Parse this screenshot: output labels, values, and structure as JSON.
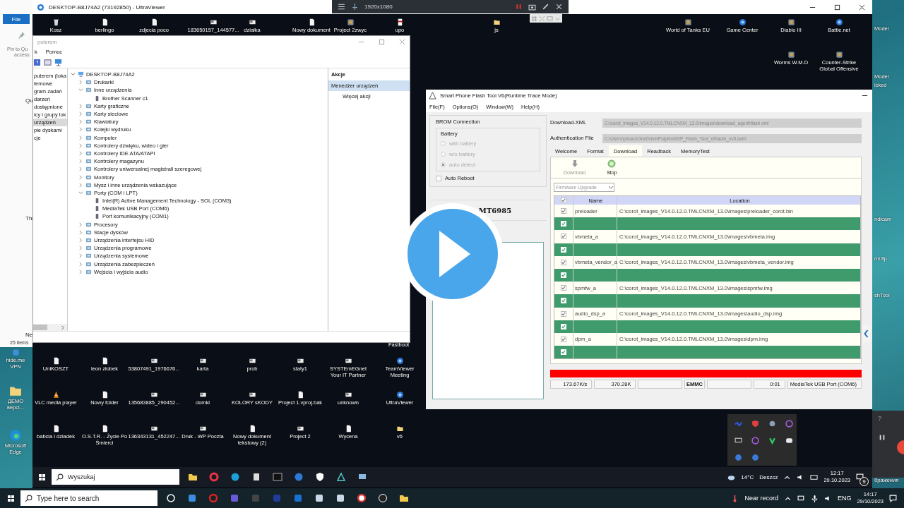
{
  "local_explorer": {
    "tab": "File",
    "pin_label": "Pin to Qu",
    "pin_label_2": "access",
    "nav_items": [
      "Qu",
      "Thi",
      "Ne"
    ],
    "status": "25 items"
  },
  "local_desktop_left": [
    {
      "label": "hide.me VPN",
      "kind": "app"
    },
    {
      "label": "ДЕМО версi...",
      "kind": "folder"
    },
    {
      "label": "Microsoft Edge",
      "kind": "web"
    }
  ],
  "local_desktop_right": [
    "Model",
    "Model",
    "icked",
    "ndicam",
    "mi.flp",
    "shTool",
    "бражения"
  ],
  "recorder_bar": {
    "resolution": "1920x1080"
  },
  "remote_window": {
    "title": "DESKTOP-B8J74A2 (73192850) - UltraViewer"
  },
  "remote_desktop_top": [
    {
      "label": "Kosz",
      "kind": "recycle"
    },
    {
      "label": "berlingo",
      "kind": "file"
    },
    {
      "label": "zdjecia poco",
      "kind": "file"
    },
    {
      "label": "183650157_144577...",
      "kind": "image"
    },
    {
      "label": "działka",
      "kind": "image"
    },
    {
      "label": "Nowy dokument",
      "kind": "file"
    },
    {
      "label": "Project 2zwyc",
      "kind": "app"
    },
    {
      "label": "upo",
      "kind": "pdf"
    },
    {
      "label": "js",
      "kind": "folder"
    },
    {
      "label": "World of Tanks EU",
      "kind": "app"
    },
    {
      "label": "Game Center",
      "kind": "web"
    },
    {
      "label": "Diablo III",
      "kind": "app"
    },
    {
      "label": "Battle.net",
      "kind": "web"
    },
    {
      "label": "Worms W.M.D",
      "kind": "app"
    },
    {
      "label": "Counter-Strike Global Offensive",
      "kind": "app"
    }
  ],
  "remote_desktop_bottom": [
    {
      "label": "UniKOSZT",
      "kind": "file"
    },
    {
      "label": "leon złobek",
      "kind": "file"
    },
    {
      "label": "53807491_1976676...",
      "kind": "image"
    },
    {
      "label": "karta",
      "kind": "image"
    },
    {
      "label": "prob",
      "kind": "image"
    },
    {
      "label": "staty1",
      "kind": "image"
    },
    {
      "label": "SYSTEmEGnet Your IT Partner",
      "kind": "image"
    },
    {
      "label": "TeamViewer Meeting",
      "kind": "web"
    },
    {
      "label": "VLC media player",
      "kind": "cone"
    },
    {
      "label": "Nowy folder",
      "kind": "file"
    },
    {
      "label": "135683885_290452...",
      "kind": "image"
    },
    {
      "label": "domki",
      "kind": "image"
    },
    {
      "label": "KOLORY sKODY",
      "kind": "image"
    },
    {
      "label": "Project 1.vproj.bak",
      "kind": "file"
    },
    {
      "label": "unknown",
      "kind": "image"
    },
    {
      "label": "UltraViewer",
      "kind": "web"
    },
    {
      "label": "babcia i dziadek",
      "kind": "file"
    },
    {
      "label": "O.S.T.R. - Życie Po Śmierci",
      "kind": "file"
    },
    {
      "label": "136343131_452247...",
      "kind": "image"
    },
    {
      "label": "Druk - WP Poczta",
      "kind": "image"
    },
    {
      "label": "Nowy dokument tekstowy (2)",
      "kind": "file"
    },
    {
      "label": "Project 2",
      "kind": "image"
    },
    {
      "label": "Wycena",
      "kind": "file"
    },
    {
      "label": "v6",
      "kind": "folder"
    }
  ],
  "remote_desktop_hidden_label": "Fastboot",
  "device_manager": {
    "title": "puterem",
    "menu": [
      "k",
      "Pomoc"
    ],
    "nav": [
      {
        "label": "puterem (loka",
        "selected": false
      },
      {
        "label": "temowe",
        "selected": false
      },
      {
        "label": "gram zadań",
        "selected": false
      },
      {
        "label": "darzeń",
        "selected": false
      },
      {
        "label": "dostępnione",
        "selected": false
      },
      {
        "label": "icy i grupy lok",
        "selected": false
      },
      {
        "label": "urządzeń",
        "selected": true
      },
      {
        "label": "pie dyskami",
        "selected": false
      },
      {
        "label": "cje",
        "selected": false
      }
    ],
    "tree": {
      "label": "DESKTOP-B8J74A2",
      "expanded": true,
      "children": [
        {
          "label": "Drukarki",
          "expanded": false
        },
        {
          "label": "Inne urządzenia",
          "expanded": true,
          "children": [
            "Brother Scanner c1"
          ]
        },
        {
          "label": "Karty graficzne",
          "expanded": false
        },
        {
          "label": "Karty sieciowe",
          "expanded": false
        },
        {
          "label": "Klawiatury",
          "expanded": false
        },
        {
          "label": "Kolejki wydruku",
          "expanded": false
        },
        {
          "label": "Komputer",
          "expanded": false
        },
        {
          "label": "Kontrolery dźwięku, wideo i gier",
          "expanded": false
        },
        {
          "label": "Kontrolery IDE ATA/ATAPI",
          "expanded": false
        },
        {
          "label": "Kontrolery magazynu",
          "expanded": false
        },
        {
          "label": "Kontrolery uniwersalnej magistrali szeregowej",
          "expanded": false
        },
        {
          "label": "Monitory",
          "expanded": false
        },
        {
          "label": "Mysz i inne urządzenia wskazujące",
          "expanded": false
        },
        {
          "label": "Porty (COM i LPT)",
          "expanded": true,
          "children": [
            "Intel(R) Active Management Technology - SOL (COM3)",
            "MediaTek USB Port (COM6)",
            "Port komunikacyjny (COM1)"
          ]
        },
        {
          "label": "Procesory",
          "expanded": false
        },
        {
          "label": "Stacje dysków",
          "expanded": false
        },
        {
          "label": "Urządzenia interfejsu HID",
          "expanded": false
        },
        {
          "label": "Urządzenia programowe",
          "expanded": false
        },
        {
          "label": "Urządzenia systemowe",
          "expanded": false
        },
        {
          "label": "Urządzenia zabezpieczeń",
          "expanded": false
        },
        {
          "label": "Wejścia i wyjścia audio",
          "expanded": false
        }
      ]
    },
    "actions": {
      "heading": "Akcje",
      "items": [
        {
          "label": "Menedżer urządzeń",
          "selected": true
        },
        {
          "label": "Więcej akcji",
          "selected": false
        }
      ]
    }
  },
  "flash_tool": {
    "title": "Smart Phone Flash Tool V6(Runtime Trace Mode)",
    "menu": [
      "File(F)",
      "Options(O)",
      "Window(W)",
      "Help(H)"
    ],
    "connection": {
      "title": "BROM Connection",
      "battery_title": "Battery",
      "disabled": true,
      "battery": [
        {
          "label": "with battery",
          "selected": false
        },
        {
          "label": "w/o battery",
          "selected": false
        },
        {
          "label": "auto detect",
          "selected": true
        }
      ],
      "auto_reboot": {
        "label": "Auto Reboot",
        "checked": false
      }
    },
    "chip": "MT6985",
    "download_xml": {
      "label": "Download-XML",
      "value": "C:\\corot_images_V14.0.12.0.TMLCNXM_13.0\\images\\download_agent\\flash.xml"
    },
    "auth_file": {
      "label": "Authentication File",
      "value": "C:\\Users\\pikuro\\OneDrive\\Pulpit\\v6\\SP_Flash_Tool_V6\\auth_sv5.auth"
    },
    "tabs": [
      {
        "label": "Welcome",
        "selected": false
      },
      {
        "label": "Format",
        "selected": false
      },
      {
        "label": "Download",
        "selected": true
      },
      {
        "label": "Readback",
        "selected": false
      },
      {
        "label": "MemoryTest",
        "selected": false
      }
    ],
    "actions": [
      {
        "label": "Download",
        "kind": "download",
        "disabled": true
      },
      {
        "label": "Stop",
        "kind": "stop",
        "disabled": false
      }
    ],
    "mode": "Firmware Upgrade",
    "columns": [
      "Name",
      "Location"
    ],
    "all_checked": true,
    "rows": [
      {
        "name": "preloader",
        "location": "C:\\corot_images_V14.0.12.0.TMLCNXM_13.0\\images\\preloader_corot.bin",
        "checked": true,
        "selected": false
      },
      {
        "checked": true,
        "selected": true
      },
      {
        "name": "vbmeta_a",
        "location": "C:\\corot_images_V14.0.12.0.TMLCNXM_13.0\\images\\vbmeta.img",
        "checked": true,
        "selected": false
      },
      {
        "checked": true,
        "selected": true
      },
      {
        "name": "vbmeta_vendor_a",
        "location": "C:\\corot_images_V14.0.12.0.TMLCNXM_13.0\\images\\vbmeta_vendor.img",
        "checked": true,
        "selected": false
      },
      {
        "checked": true,
        "selected": true
      },
      {
        "name": "spmfw_a",
        "location": "C:\\corot_images_V14.0.12.0.TMLCNXM_13.0\\images\\spmfw.img",
        "checked": true,
        "selected": false
      },
      {
        "checked": true,
        "selected": true
      },
      {
        "name": "audio_dsp_a",
        "location": "C:\\corot_images_V14.0.12.0.TMLCNXM_13.0\\images\\audio_dsp.img",
        "checked": true,
        "selected": false
      },
      {
        "checked": true,
        "selected": true
      },
      {
        "name": "dpm_a",
        "location": "C:\\corot_images_V14.0.12.0.TMLCNXM_13.0\\images\\dpm.img",
        "checked": true,
        "selected": false
      },
      {
        "checked": true,
        "selected": true
      }
    ],
    "progress": {
      "level": 1
    },
    "status": [
      "173.67K/s",
      "370.28K",
      "EMMC",
      "0:01",
      "MediaTek USB Port (COM6)"
    ]
  },
  "remote_taskbar": {
    "search_placeholder": "Wyszukaj",
    "temperature": "14°C",
    "weather": "Deszcz",
    "time": "12:17",
    "date": "29.10.2023",
    "notifications": "9"
  },
  "local_taskbar": {
    "search_placeholder": "Type here to search",
    "weather": "Near record",
    "language": "ENG",
    "time": "14:17",
    "date": "29/10/2023"
  },
  "recorder_panel": {
    "help": "?"
  }
}
